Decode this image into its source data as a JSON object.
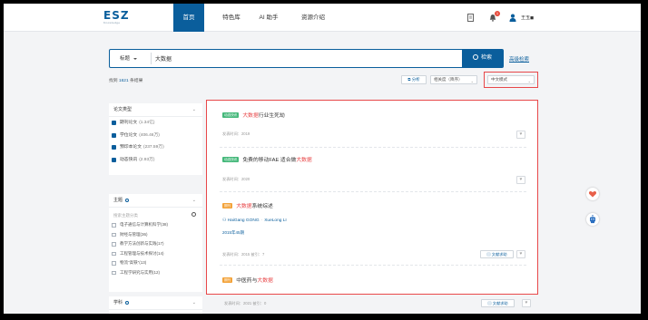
{
  "brand": {
    "logo_main": "ESZ",
    "logo_sub": "Knowledge",
    "primary_color": "#0a5e9c",
    "highlight_color": "#e8484a"
  },
  "nav": {
    "items": [
      {
        "label": "首页",
        "active": true
      },
      {
        "label": "特色库",
        "active": false
      },
      {
        "label": "AI 助手",
        "active": false
      },
      {
        "label": "资源介绍",
        "active": false
      }
    ],
    "notification_count": "1",
    "username": "王玉◼",
    "icons": [
      "document-icon",
      "bell-icon",
      "user-icon"
    ]
  },
  "search": {
    "field": "标题",
    "query": "大数据",
    "button_label": "检索",
    "advanced_label": "高级检索"
  },
  "results_bar": {
    "count_prefix": "找到",
    "count": "1621",
    "count_suffix": "条结果",
    "analyze_label": "分析",
    "sort_label": "相关度（降序）",
    "mode_label": "中文模式"
  },
  "filters": {
    "doc_type": {
      "title": "论文类型",
      "items": [
        {
          "label": "期刊论文",
          "count": "(1.34亿)",
          "checked": true
        },
        {
          "label": "学位论文",
          "count": "(406.46万)",
          "checked": true
        },
        {
          "label": "预印本论文",
          "count": "(237.59万)",
          "checked": true
        },
        {
          "label": "动态快讯",
          "count": "(2.93万)",
          "checked": true
        }
      ]
    },
    "topic": {
      "title": "主题",
      "search_placeholder": "搜索主题分类",
      "items": [
        {
          "label": "电子通信与计算机科学",
          "count": "(38)"
        },
        {
          "label": "财经与管理",
          "count": "(36)"
        },
        {
          "label": "教学方法创新与实践",
          "count": "(17)"
        },
        {
          "label": "工程管理与技术探讨",
          "count": "(14)"
        },
        {
          "label": "物流\"高铁\"",
          "count": "(13)"
        },
        {
          "label": "工程学研究与实用",
          "count": "(12)"
        }
      ]
    },
    "subject": {
      "title": "学科"
    }
  },
  "results": [
    {
      "tag": "动态快讯",
      "tag_type": "news",
      "title_before": "",
      "title_kw": "大数据",
      "title_after": "行业生死劫",
      "meta": "发表时间：2019"
    },
    {
      "tag": "动态快讯",
      "tag_type": "news",
      "title_before": "免费的移动FAE 适合做",
      "title_kw": "大数据",
      "title_after": "",
      "meta": "发表时间：2020"
    },
    {
      "tag": "期刊",
      "tag_type": "journal",
      "title_before": "",
      "title_kw": "大数据",
      "title_after": "系统综述",
      "author_1": "HaiGang GONG",
      "author_2": "XueLong LI",
      "issue": "2015年45期",
      "meta": "发表时间：2015 被引：7",
      "ref_label": "文献求助"
    },
    {
      "tag": "期刊",
      "tag_type": "journal",
      "title_before": "中医药与",
      "title_kw": "大数据",
      "title_after": ""
    }
  ],
  "below": {
    "meta": "发表时间：2021 被引：0",
    "ref_label": "文献求助"
  }
}
